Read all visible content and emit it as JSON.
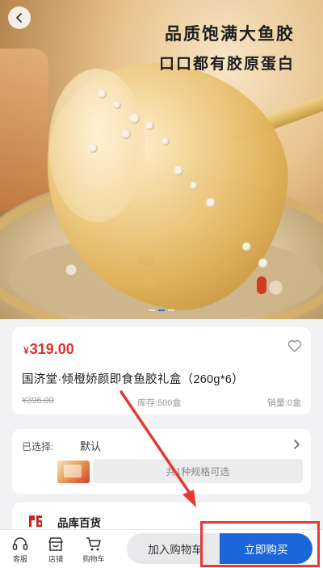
{
  "hero": {
    "headline_line1": "品质饱满大鱼胶",
    "headline_line2": "口口都有胶原蛋白",
    "slides_total": 3,
    "slides_active": 2
  },
  "product": {
    "currency": "¥",
    "price": "319.00",
    "title": "国济堂·倾橙娇颜即食鱼胶礼盒（260g*6）",
    "original_price": "¥396.00",
    "stock": "库存:500盒",
    "sales": "销量:0盒"
  },
  "spec": {
    "label": "已选择:",
    "value": "默认",
    "options_text": "共1种规格可选"
  },
  "store": {
    "name": "品库百货"
  },
  "bottom_bar": {
    "tabs": [
      {
        "label": "客服",
        "icon": "headset-icon"
      },
      {
        "label": "店铺",
        "icon": "store-icon"
      },
      {
        "label": "购物车",
        "icon": "cart-icon"
      }
    ],
    "add_to_cart": "加入购物车",
    "buy_now": "立即购买"
  },
  "colors": {
    "price": "#e0302a",
    "buy_button": "#1b66d8",
    "annotation": "#e53a2f"
  }
}
